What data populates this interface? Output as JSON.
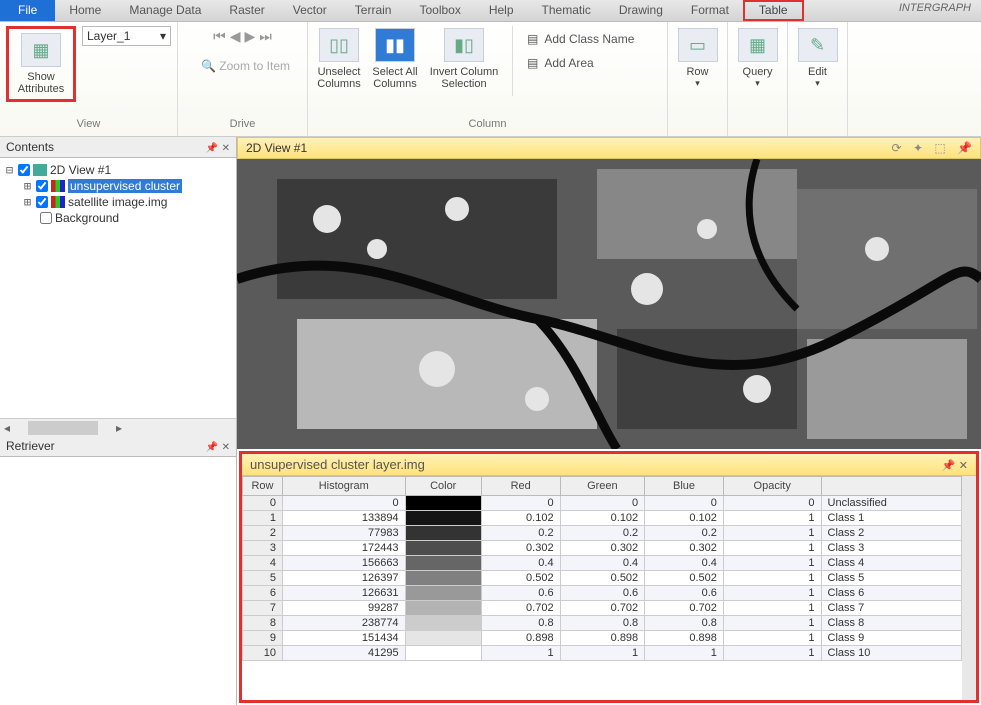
{
  "menu": {
    "file": "File",
    "items": [
      "Home",
      "Manage Data",
      "Raster",
      "Vector",
      "Terrain",
      "Toolbox",
      "Help",
      "Thematic",
      "Drawing",
      "Format"
    ],
    "table": "Table",
    "brand": "INTERGRAPH"
  },
  "ribbon": {
    "show_attributes": "Show Attributes",
    "layer_value": "Layer_1",
    "zoom_to_item": "Zoom to Item",
    "unselect_columns": "Unselect Columns",
    "select_all_columns": "Select All Columns",
    "invert_column_selection": "Invert Column Selection",
    "add_class_name": "Add Class Name",
    "add_area": "Add Area",
    "row": "Row",
    "query": "Query",
    "edit": "Edit",
    "grp_view": "View",
    "grp_drive": "Drive",
    "grp_column": "Column"
  },
  "contents": {
    "title": "Contents",
    "root": "2D View #1",
    "unsup": "unsupervised cluster",
    "sat": "satellite image.img",
    "bg": "Background"
  },
  "retriever": {
    "title": "Retriever"
  },
  "view2d": {
    "title": "2D View #1"
  },
  "attrtable": {
    "title": "unsupervised cluster layer.img",
    "headers": [
      "Row",
      "Histogram",
      "Color",
      "Red",
      "Green",
      "Blue",
      "Opacity",
      ""
    ],
    "rows": [
      {
        "row": 0,
        "hist": 0,
        "color": "#000000",
        "r": "0",
        "g": "0",
        "b": "0",
        "op": "0",
        "cls": "Unclassified"
      },
      {
        "row": 1,
        "hist": 133894,
        "color": "#151515",
        "r": "0.102",
        "g": "0.102",
        "b": "0.102",
        "op": "1",
        "cls": "Class 1"
      },
      {
        "row": 2,
        "hist": 77983,
        "color": "#333333",
        "r": "0.2",
        "g": "0.2",
        "b": "0.2",
        "op": "1",
        "cls": "Class 2"
      },
      {
        "row": 3,
        "hist": 172443,
        "color": "#4d4d4d",
        "r": "0.302",
        "g": "0.302",
        "b": "0.302",
        "op": "1",
        "cls": "Class 3"
      },
      {
        "row": 4,
        "hist": 156663,
        "color": "#666666",
        "r": "0.4",
        "g": "0.4",
        "b": "0.4",
        "op": "1",
        "cls": "Class 4"
      },
      {
        "row": 5,
        "hist": 126397,
        "color": "#808080",
        "r": "0.502",
        "g": "0.502",
        "b": "0.502",
        "op": "1",
        "cls": "Class 5"
      },
      {
        "row": 6,
        "hist": 126631,
        "color": "#999999",
        "r": "0.6",
        "g": "0.6",
        "b": "0.6",
        "op": "1",
        "cls": "Class 6"
      },
      {
        "row": 7,
        "hist": 99287,
        "color": "#b3b3b3",
        "r": "0.702",
        "g": "0.702",
        "b": "0.702",
        "op": "1",
        "cls": "Class 7"
      },
      {
        "row": 8,
        "hist": 238774,
        "color": "#cccccc",
        "r": "0.8",
        "g": "0.8",
        "b": "0.8",
        "op": "1",
        "cls": "Class 8"
      },
      {
        "row": 9,
        "hist": 151434,
        "color": "#e5e5e5",
        "r": "0.898",
        "g": "0.898",
        "b": "0.898",
        "op": "1",
        "cls": "Class 9"
      },
      {
        "row": 10,
        "hist": 41295,
        "color": "#ffffff",
        "r": "1",
        "g": "1",
        "b": "1",
        "op": "1",
        "cls": "Class 10"
      }
    ]
  }
}
